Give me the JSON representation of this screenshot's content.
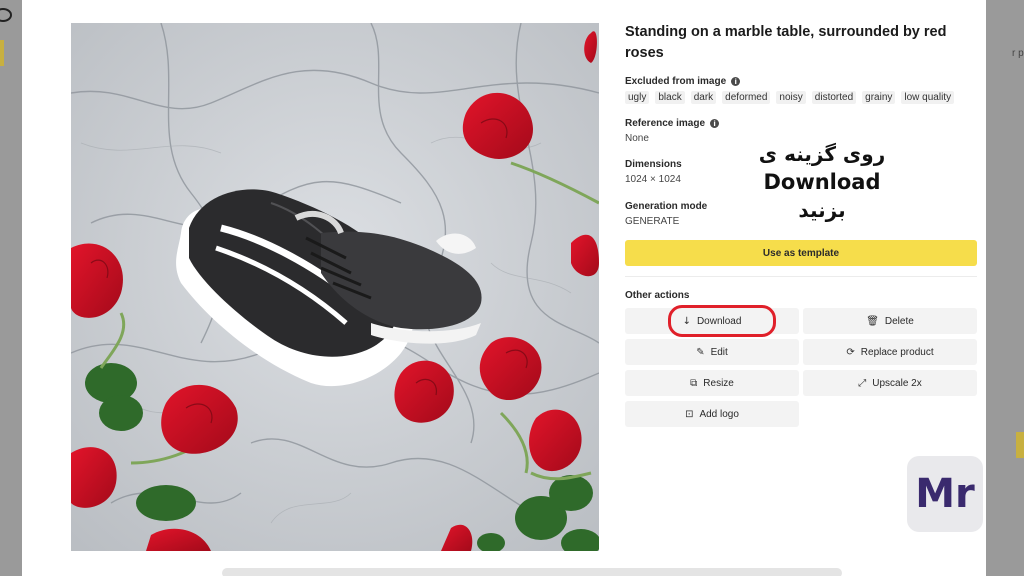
{
  "background": {
    "right_edge_text": "r p"
  },
  "image": {
    "alt": "Black and white sneaker on marble table with red roses"
  },
  "details": {
    "title": "Standing on a marble table, surrounded by red roses",
    "excluded_label": "Excluded from image",
    "excluded_tags": [
      "ugly",
      "black",
      "dark",
      "deformed",
      "noisy",
      "distorted",
      "grainy",
      "low quality"
    ],
    "reference_label": "Reference image",
    "reference_value": "None",
    "dimensions_label": "Dimensions",
    "dimensions_value": "1024 × 1024",
    "generation_label": "Generation mode",
    "generation_value": "GENERATE",
    "template_button": "Use as template"
  },
  "actions": {
    "heading": "Other actions",
    "download": "Download",
    "delete": "Delete",
    "edit": "Edit",
    "replace_product": "Replace product",
    "resize": "Resize",
    "upscale": "Upscale 2x",
    "add_logo": "Add logo"
  },
  "overlay": {
    "line1": "روی گزینه ی",
    "line2": "Download",
    "line3": "بزنید",
    "highlight_color": "#e0202a"
  },
  "watermark": {
    "text": "Mr",
    "color": "#3a2a6e"
  },
  "colors": {
    "accent_yellow": "#f6dd4b"
  }
}
